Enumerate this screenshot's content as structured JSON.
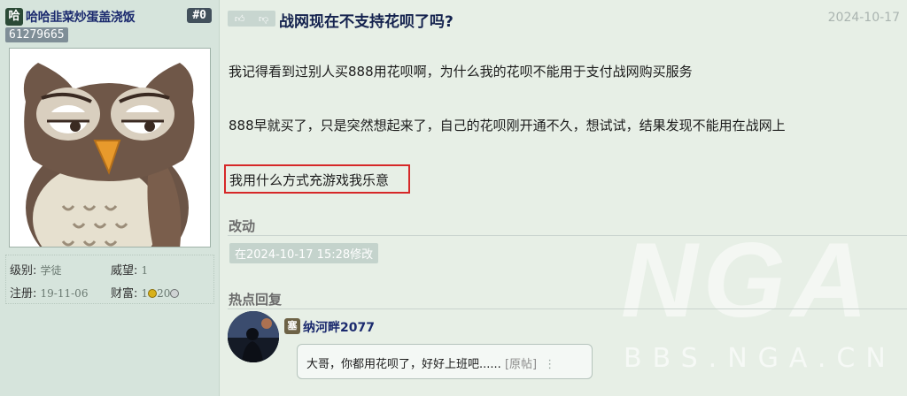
{
  "user": {
    "badge": "哈",
    "name": "哈哈韭菜炒蛋盖浇饭",
    "floor": "#0",
    "uid": "61279665",
    "stats": {
      "level_label": "级别:",
      "level_value": "学徒",
      "prestige_label": "威望:",
      "prestige_value": "1",
      "register_label": "注册:",
      "register_value": "19-11-06",
      "wealth_label": "财富:",
      "wealth_a": "1",
      "wealth_b": "20"
    }
  },
  "post": {
    "title": "战网现在不支持花呗了吗?",
    "date": "2024-10-17",
    "paragraphs": [
      "我记得看到过别人买888用花呗啊，为什么我的花呗不能用于支付战网购买服务",
      "888早就买了，只是突然想起来了，自己的花呗刚开通不久，想试试，结果发现不能用在战网上"
    ],
    "highlighted": "我用什么方式充游戏我乐意",
    "edit_section_title": "改动",
    "edit_note": "在2024-10-17 15:28修改",
    "hot_section_title": "热点回复"
  },
  "reply": {
    "badge": "塞",
    "name": "纳河畔2077",
    "text": "大哥，你都用花呗了，好好上班吧......",
    "link": "[原帖]",
    "more": "⋮"
  },
  "watermark": {
    "logo": "NGA",
    "url": "BBS.NGA.CN"
  },
  "colors": {
    "page_bg": "#e7efe6",
    "panel_bg": "#d6e4dc",
    "title": "#14224e",
    "highlight_border": "#d62828"
  }
}
